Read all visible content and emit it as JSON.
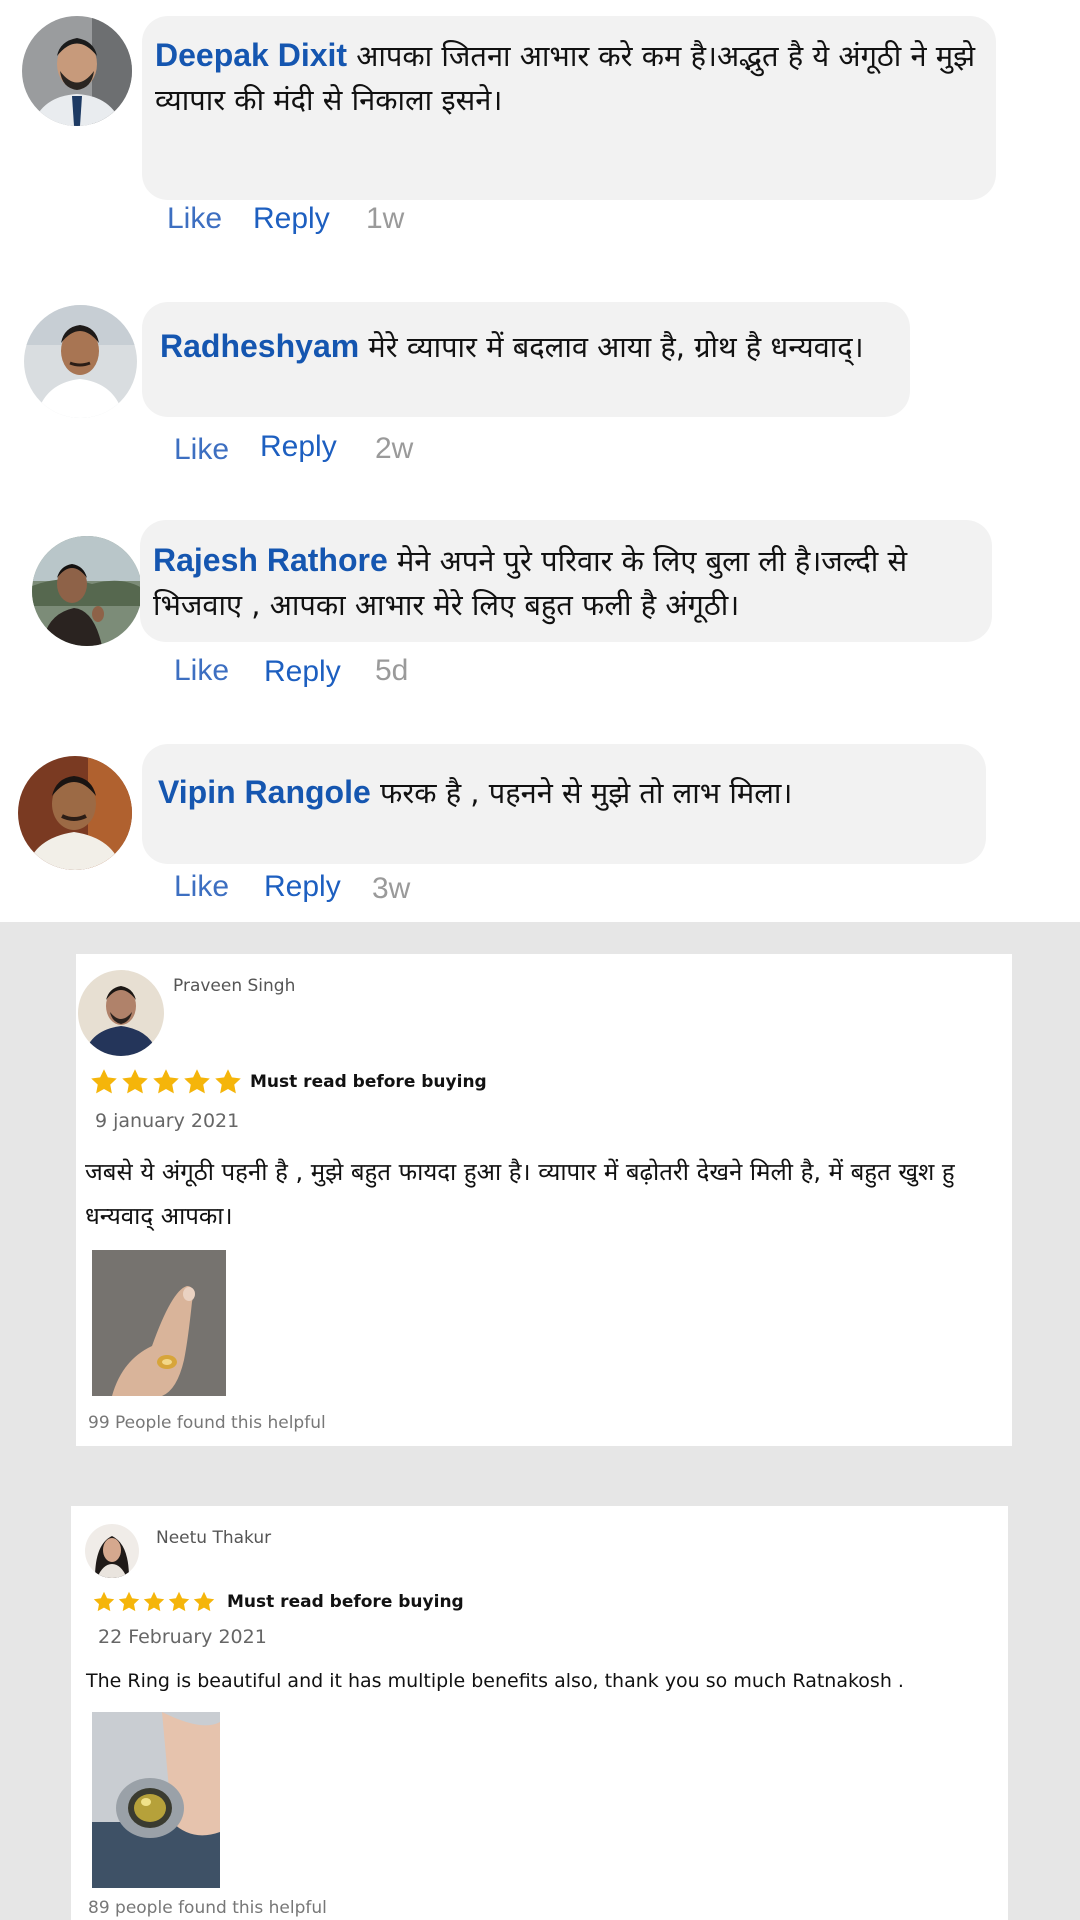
{
  "comments": [
    {
      "name": "Deepak Dixit",
      "text": "आपका जितना आभार करे कम है।अद्भुत है ये अंगूठी ने मुझे व्यापार की मंदी से निकाला इसने।",
      "like": "Like",
      "reply": "Reply",
      "time": "1w"
    },
    {
      "name": "Radheshyam",
      "text": "मेरे व्यापार में बदलाव आया है, ग्रोथ है धन्यवाद्।",
      "like": "Like",
      "reply": "Reply",
      "time": "2w"
    },
    {
      "name": "Rajesh Rathore",
      "text": "मेने अपने पुरे परिवार के लिए बुला ली है।जल्दी से भिजवाए , आपका आभार मेरे लिए बहुत फली है अंगूठी।",
      "like": "Like",
      "reply": "Reply",
      "time": "5d"
    },
    {
      "name": "Vipin Rangole",
      "text": "फरक है , पहनने से मुझे तो लाभ मिला।",
      "like": "Like",
      "reply": "Reply",
      "time": "3w"
    }
  ],
  "reviews": [
    {
      "name": "Praveen Singh",
      "rating": 5,
      "title": "Must read before buying",
      "date": "9 january 2021",
      "text": "जबसे ये अंगूठी पहनी है , मुझे बहुत फायदा हुआ है।  व्यापार में बढ़ोतरी देखने मिली है, में बहुत खुश हु धन्यवाद् आपका।",
      "helpful": "99 People found this helpful"
    },
    {
      "name": "Neetu Thakur",
      "rating": 5,
      "title": "Must read before buying",
      "date": "22 February 2021",
      "text": "The Ring is beautiful and it has multiple benefits also, thank you so much Ratnakosh .",
      "helpful": "89 people found this helpful"
    }
  ],
  "colors": {
    "name_blue": "#1556b0",
    "star": "#f5b50a",
    "bubble": "#f2f2f2",
    "section_bg": "#e6e6e6"
  },
  "icons": {
    "star": "star-icon"
  }
}
